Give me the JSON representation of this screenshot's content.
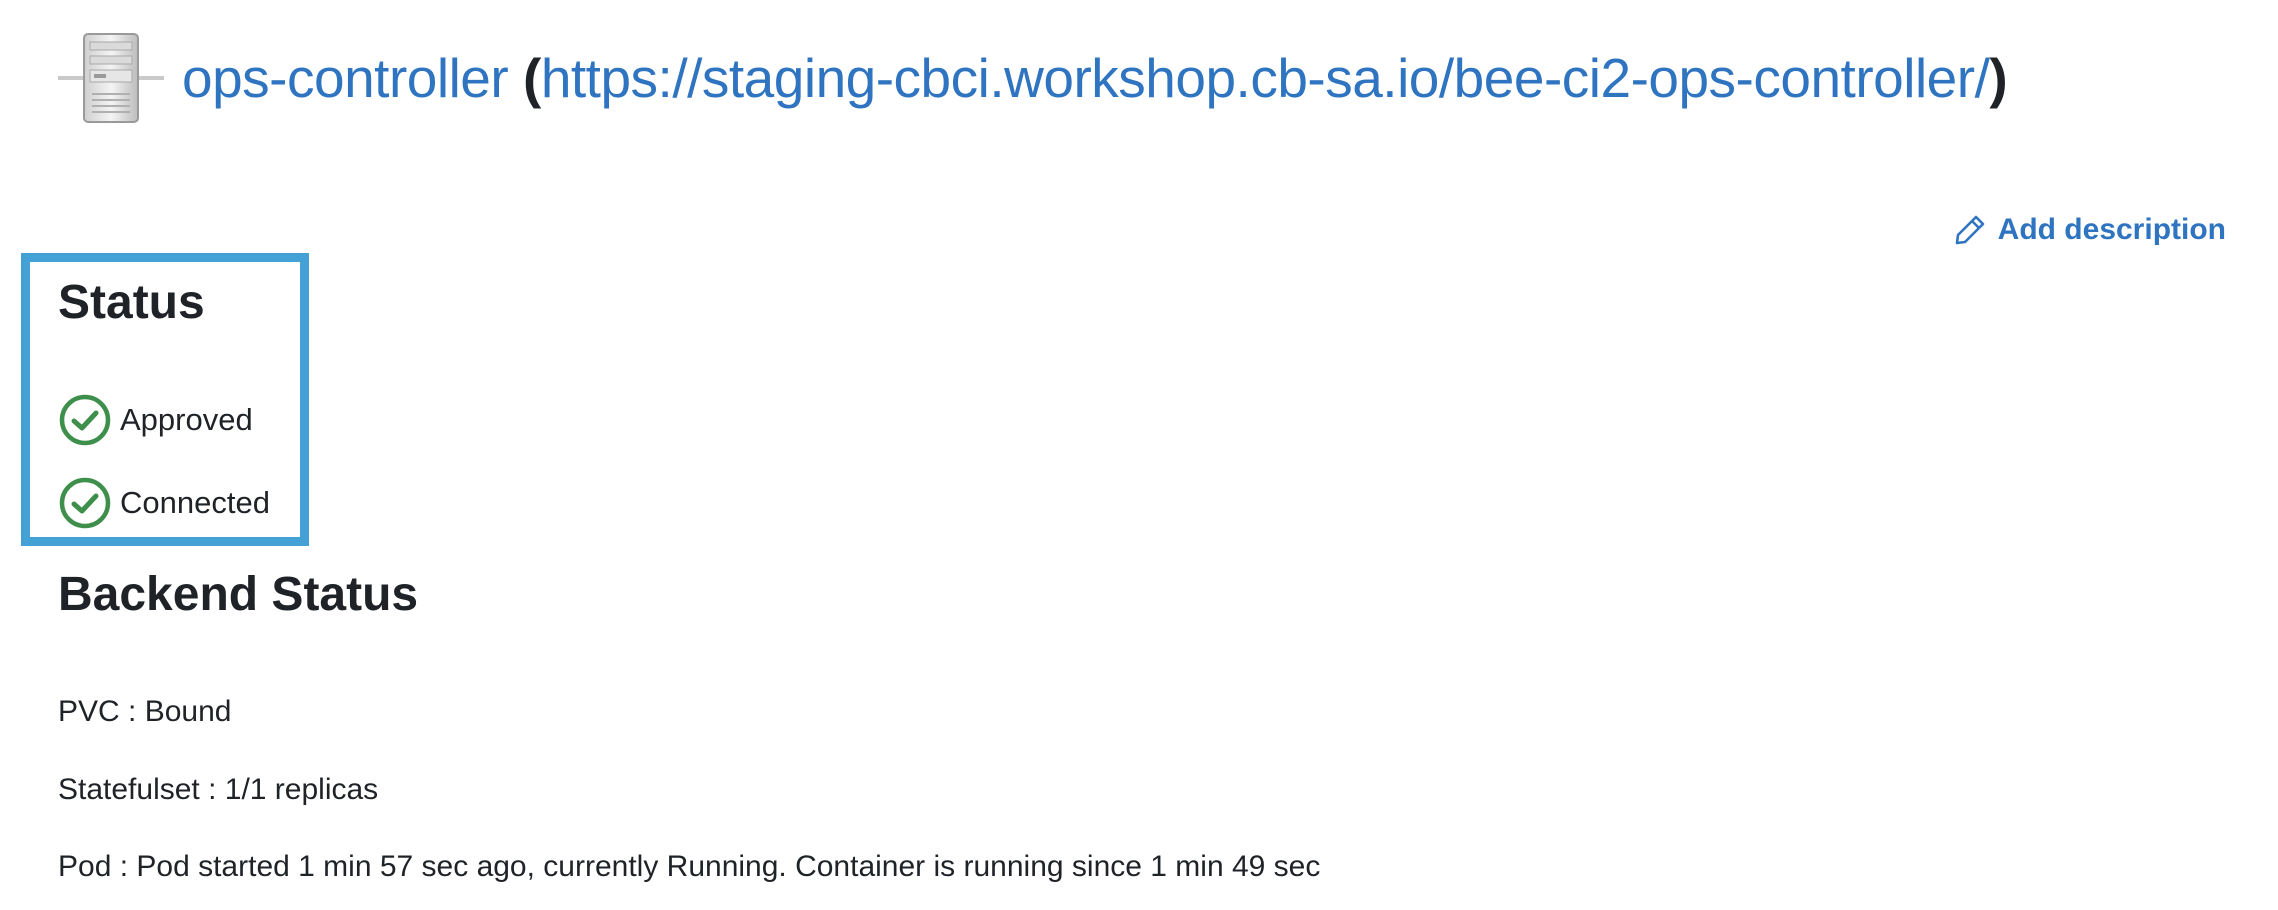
{
  "header": {
    "name": "ops-controller",
    "open_paren": "(",
    "url": "https://staging-cbci.workshop.cb-sa.io/bee-ci2-ops-controller/",
    "close_paren": ")",
    "icon": "server-icon"
  },
  "actions": {
    "add_description": "Add description",
    "add_description_icon": "pencil-icon"
  },
  "status": {
    "title": "Status",
    "items": [
      {
        "label": "Approved",
        "icon": "check-circle-icon",
        "color": "#3f8f4c"
      },
      {
        "label": "Connected",
        "icon": "check-circle-icon",
        "color": "#3f8f4c"
      }
    ],
    "highlight_color": "#43a1d5"
  },
  "backend": {
    "title": "Backend Status",
    "lines": [
      "PVC : Bound",
      "Statefulset : 1/1 replicas",
      "Pod : Pod started 1 min 57 sec ago, currently Running. Container is running since 1 min 49 sec"
    ]
  },
  "colors": {
    "link": "#2f74c0",
    "text": "#1f2328"
  }
}
